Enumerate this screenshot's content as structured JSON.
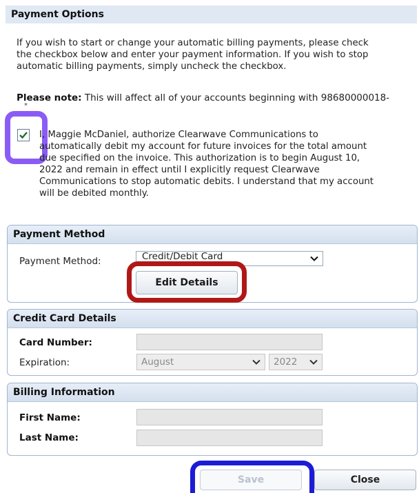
{
  "payment_options": {
    "title": "Payment Options",
    "intro_lines": [
      "If you wish to start or change your automatic billing payments, please check",
      "the checkbox below and enter your payment information. If you wish to stop",
      "automatic billing payments, simply uncheck the checkbox."
    ],
    "note_label": "Please note:",
    "note_text": " This will affect all of your accounts beginning with 98680000018-",
    "note_overflow": "*",
    "authorization_checked": true,
    "authorization_lines": [
      "I, Maggie McDaniel, authorize Clearwave Communications to",
      "automatically debit my account for future invoices for the total amount",
      "due specified on the invoice. This authorization is to begin August 10,",
      "2022 and remain in effect until I explicitly request Clearwave",
      "Communications to stop automatic debits. I understand that my account",
      "will be debited monthly."
    ]
  },
  "payment_method": {
    "title": "Payment Method",
    "label": "Payment Method:",
    "selected": "Credit/Debit Card",
    "edit_button": "Edit Details"
  },
  "credit_card": {
    "title": "Credit Card Details",
    "card_number_label": "Card Number:",
    "card_number_value": "",
    "expiration_label": "Expiration:",
    "expiration_month": "August",
    "expiration_year": "2022"
  },
  "billing": {
    "title": "Billing Information",
    "first_name_label": "First Name:",
    "first_name_value": "",
    "last_name_label": "Last Name:",
    "last_name_value": ""
  },
  "actions": {
    "save_label": "Save",
    "close_label": "Close"
  },
  "highlight_colors": {
    "checkbox_ring": "#8a5cf5",
    "edit_ring": "#b01818",
    "save_ring": "#1c1cd6"
  }
}
